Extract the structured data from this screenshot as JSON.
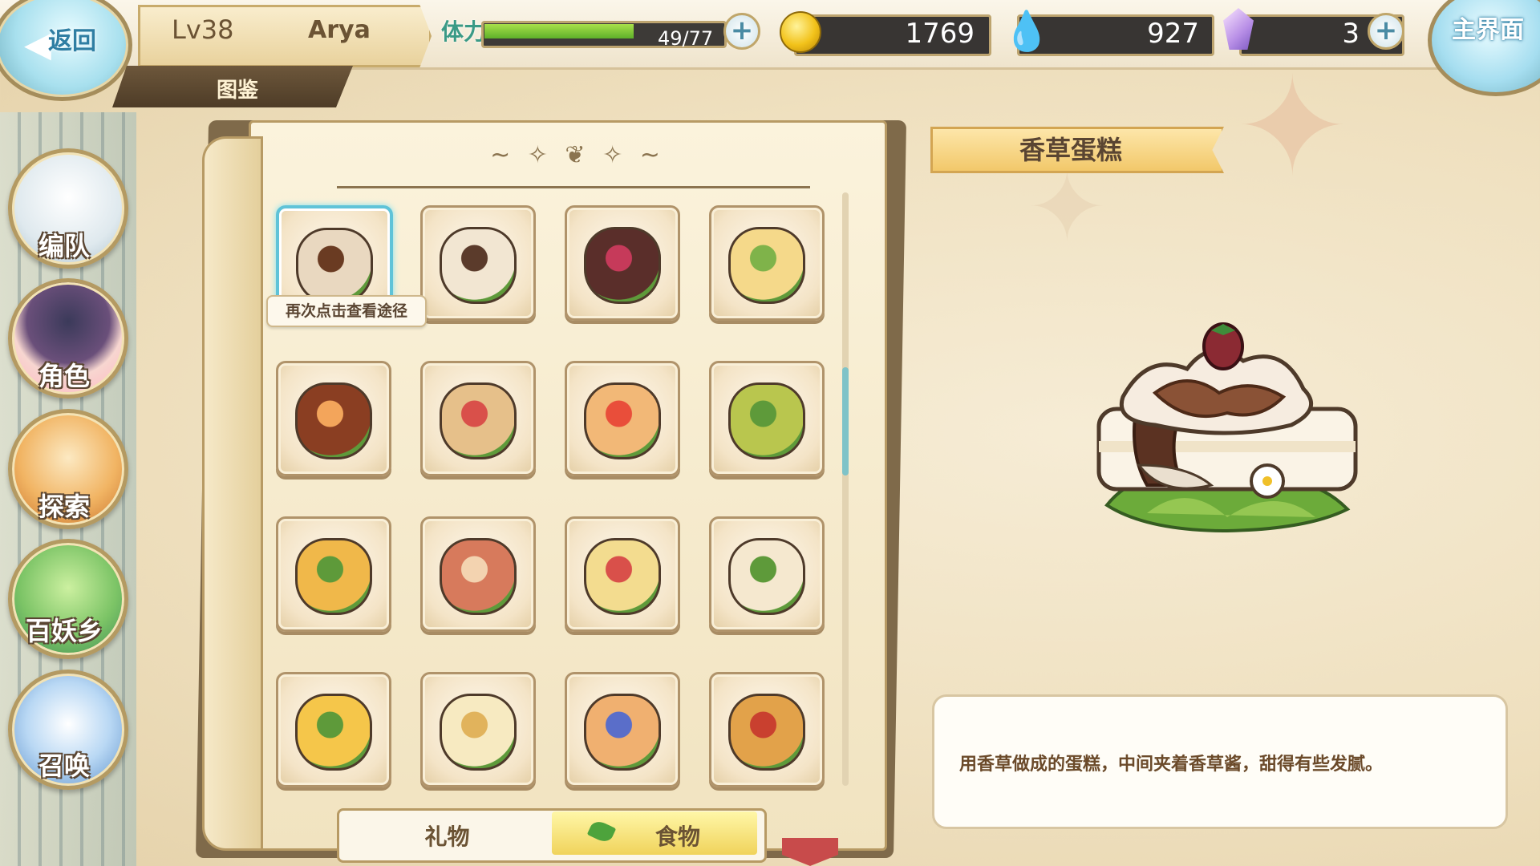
{
  "header": {
    "back_label": "返回",
    "level": "Lv38",
    "player_name": "Arya",
    "stamina_label": "体力",
    "stamina_text": "49/77",
    "stamina_fraction": 0.636,
    "gold": "1769",
    "soul": "927",
    "gems": "3",
    "home_label": "主界面"
  },
  "page_title": "图鉴",
  "nav": {
    "team": "编队",
    "character": "角色",
    "explore": "探索",
    "village": "百妖乡",
    "summon": "召唤"
  },
  "codex": {
    "tooltip": "再次点击查看途径",
    "items": [
      {
        "name": "香草蛋糕",
        "icon": "vanilla-cake",
        "color": "#e9d8c0",
        "accent": "#6a3b22",
        "selected": true
      },
      {
        "name": "",
        "icon": "flower-cake",
        "color": "#f2e6d2",
        "accent": "#5b3b2b"
      },
      {
        "name": "",
        "icon": "berry-chocolate-cake",
        "color": "#5a2e2a",
        "accent": "#c63a5a"
      },
      {
        "name": "",
        "icon": "lemon-roll-cake",
        "color": "#f5d98a",
        "accent": "#7fb34a"
      },
      {
        "name": "",
        "icon": "halloween-cake",
        "color": "#8a3e22",
        "accent": "#f3a55b"
      },
      {
        "name": "",
        "icon": "sandwich",
        "color": "#e6c08a",
        "accent": "#d9504a"
      },
      {
        "name": "",
        "icon": "hot-dog",
        "color": "#f2b877",
        "accent": "#e94e3a"
      },
      {
        "name": "",
        "icon": "leaf-wrapped-rice",
        "color": "#b9c64e",
        "accent": "#5e9a3a"
      },
      {
        "name": "",
        "icon": "leaf-dumplings",
        "color": "#f0b84a",
        "accent": "#5e9a3a"
      },
      {
        "name": "",
        "icon": "bacon-roll",
        "color": "#d77a5c",
        "accent": "#f3d3b0"
      },
      {
        "name": "",
        "icon": "omelette",
        "color": "#f3dc8f",
        "accent": "#d9504a"
      },
      {
        "name": "",
        "icon": "steamed-buns-on-leaf",
        "color": "#f5e8cf",
        "accent": "#5e9a3a"
      },
      {
        "name": "",
        "icon": "corn-rice-on-leaf",
        "color": "#f5c64a",
        "accent": "#5e9a3a"
      },
      {
        "name": "",
        "icon": "cheese-pie",
        "color": "#f7eac1",
        "accent": "#e1b35c"
      },
      {
        "name": "",
        "icon": "fruit-pie",
        "color": "#f0b070",
        "accent": "#5a6ec9"
      },
      {
        "name": "",
        "icon": "meat-bowl",
        "color": "#e2a24a",
        "accent": "#c9402f"
      }
    ]
  },
  "tabs": {
    "gift": "礼物",
    "food": "食物",
    "active": "food"
  },
  "detail": {
    "name": "香草蛋糕",
    "description": "用香草做成的蛋糕，中间夹着香草酱，甜得有些发腻。"
  }
}
